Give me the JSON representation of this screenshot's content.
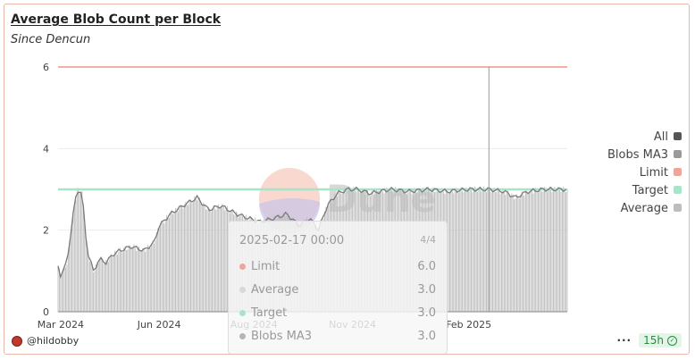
{
  "header": {
    "title": "Average Blob Count per Block",
    "subtitle": "Since Dencun"
  },
  "chart_data": {
    "type": "bar",
    "x_range": [
      "2024-03-13",
      "2025-04-20"
    ],
    "x_ticks": [
      "Mar 2024",
      "Jun 2024",
      "Aug 2024",
      "Nov 2024",
      "Feb 2025"
    ],
    "y_ticks": [
      "0",
      "2",
      "4",
      "6"
    ],
    "ylim": [
      0,
      6
    ],
    "grid": true,
    "legend_position": "right",
    "colors": {
      "all": "#555555",
      "ma3": "#9a9a9a",
      "limit": "#f0a59a",
      "target": "#a9e3c8",
      "average": "#bdbdbd"
    },
    "series": [
      {
        "name": "All",
        "kind": "legend"
      },
      {
        "name": "Blobs MA3",
        "kind": "line",
        "x": [
          "2024-03-13",
          "2024-03-15",
          "2024-03-20",
          "2024-03-25",
          "2024-03-28",
          "2024-04-01",
          "2024-04-05",
          "2024-04-10",
          "2024-04-15",
          "2024-04-20",
          "2024-04-25",
          "2024-05-01",
          "2024-05-10",
          "2024-05-20",
          "2024-05-28",
          "2024-06-01",
          "2024-06-10",
          "2024-06-20",
          "2024-07-01",
          "2024-07-10",
          "2024-07-20",
          "2024-08-01",
          "2024-08-10",
          "2024-08-20",
          "2024-09-01",
          "2024-09-10",
          "2024-09-20",
          "2024-09-28",
          "2024-10-05",
          "2024-10-12",
          "2024-10-20",
          "2024-10-28",
          "2024-11-05",
          "2024-11-15",
          "2024-12-01",
          "2024-12-15",
          "2025-01-01",
          "2025-01-15",
          "2025-02-01",
          "2025-02-17",
          "2025-03-01",
          "2025-03-10",
          "2025-03-20",
          "2025-04-01",
          "2025-04-20"
        ],
        "y": [
          1.1,
          0.9,
          1.2,
          2.4,
          3.0,
          2.9,
          1.5,
          1.0,
          1.3,
          1.2,
          1.4,
          1.5,
          1.6,
          1.5,
          1.7,
          2.1,
          2.4,
          2.6,
          2.8,
          2.5,
          2.6,
          2.4,
          2.3,
          2.2,
          2.3,
          2.4,
          2.1,
          2.3,
          2.0,
          2.6,
          2.9,
          3.0,
          3.0,
          2.9,
          3.0,
          2.95,
          3.0,
          2.95,
          3.0,
          3.0,
          2.95,
          2.8,
          2.95,
          3.0,
          3.0
        ]
      },
      {
        "name": "Limit",
        "kind": "constant",
        "value": 6
      },
      {
        "name": "Target",
        "kind": "constant",
        "value": 3
      },
      {
        "name": "Average",
        "kind": "bars",
        "same_as": "Blobs MA3"
      }
    ]
  },
  "legend": [
    {
      "label": "All",
      "color": "#555555"
    },
    {
      "label": "Blobs MA3",
      "color": "#9a9a9a"
    },
    {
      "label": "Limit",
      "color": "#f0a59a"
    },
    {
      "label": "Target",
      "color": "#a9e3c8"
    },
    {
      "label": "Average",
      "color": "#bdbdbd"
    }
  ],
  "tooltip": {
    "date": "2025-02-17 00:00",
    "count": "4/4",
    "rows": [
      {
        "label": "Limit",
        "value": "6.0",
        "color": "#f0a59a"
      },
      {
        "label": "Average",
        "value": "3.0",
        "color": "#d8d8d8"
      },
      {
        "label": "Target",
        "value": "3.0",
        "color": "#a9e3c8"
      },
      {
        "label": "Blobs MA3",
        "value": "3.0",
        "color": "#b5b5b5"
      }
    ]
  },
  "watermark": "Dune",
  "footer": {
    "author": "@hildobby",
    "refresh": "15h",
    "more_icon": "more-dots-icon"
  }
}
